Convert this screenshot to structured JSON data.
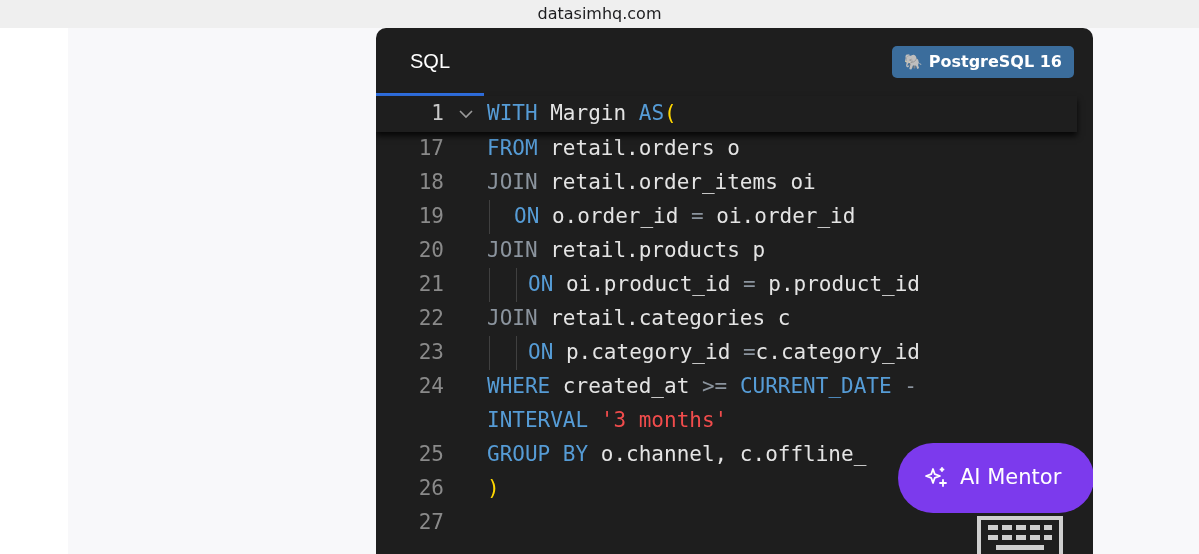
{
  "browser": {
    "url": "datasimhq.com"
  },
  "editor": {
    "tab": {
      "label": "SQL",
      "selected": true
    },
    "engine_badge": {
      "icon": "🐘",
      "label": "PostgreSQL 16"
    },
    "sticky_line": {
      "number": "1",
      "expanded": true,
      "tokens": [
        {
          "kind": "keyword",
          "text": "WITH"
        },
        {
          "kind": "text",
          "text": " Margin "
        },
        {
          "kind": "keyword",
          "text": "AS"
        },
        {
          "kind": "bracket",
          "text": "("
        }
      ]
    },
    "lines": [
      {
        "number": "17",
        "kind": "plain",
        "tokens": [
          {
            "kind": "keyword",
            "text": "FROM"
          },
          {
            "kind": "text",
            "text": " retail.orders o"
          }
        ]
      },
      {
        "number": "18",
        "kind": "plain",
        "tokens": [
          {
            "kind": "keyword_dim",
            "text": "JOIN"
          },
          {
            "kind": "text",
            "text": " retail.order_items oi"
          }
        ]
      },
      {
        "number": "19",
        "kind": "indented",
        "tokens": [
          {
            "kind": "keyword",
            "text": "ON"
          },
          {
            "kind": "text",
            "text": " o.order_id "
          },
          {
            "kind": "operator",
            "text": "="
          },
          {
            "kind": "text",
            "text": " oi.order_id"
          }
        ]
      },
      {
        "number": "20",
        "kind": "plain",
        "tokens": [
          {
            "kind": "keyword_dim",
            "text": "JOIN"
          },
          {
            "kind": "text",
            "text": " retail.products p"
          }
        ]
      },
      {
        "number": "21",
        "kind": "nested",
        "tokens": [
          {
            "kind": "keyword",
            "text": "ON"
          },
          {
            "kind": "text",
            "text": " oi.product_id "
          },
          {
            "kind": "operator",
            "text": "="
          },
          {
            "kind": "text",
            "text": " p.product_id"
          }
        ]
      },
      {
        "number": "22",
        "kind": "plain",
        "tokens": [
          {
            "kind": "keyword_dim",
            "text": "JOIN"
          },
          {
            "kind": "text",
            "text": " retail.categories c"
          }
        ]
      },
      {
        "number": "23",
        "kind": "nested",
        "tokens": [
          {
            "kind": "keyword",
            "text": "ON"
          },
          {
            "kind": "text",
            "text": " p.category_id "
          },
          {
            "kind": "operator",
            "text": "="
          },
          {
            "kind": "text",
            "text": "c.category_id"
          }
        ]
      },
      {
        "number": "24",
        "kind": "plain",
        "tokens": [
          {
            "kind": "keyword",
            "text": "WHERE"
          },
          {
            "kind": "text",
            "text": " created_at "
          },
          {
            "kind": "operator",
            "text": ">="
          },
          {
            "kind": "keyword",
            "text": " CURRENT_DATE"
          },
          {
            "kind": "operator",
            "text": " -"
          }
        ]
      },
      {
        "kind": "plain",
        "tokens": [
          {
            "kind": "keyword",
            "text": "INTERVAL"
          },
          {
            "kind": "string",
            "text": " '3 months'"
          }
        ]
      },
      {
        "number": "25",
        "kind": "plain",
        "tokens": [
          {
            "kind": "keyword",
            "text": "GROUP BY"
          },
          {
            "kind": "text",
            "text": " o.channel, c.offline_"
          }
        ]
      },
      {
        "number": "26",
        "kind": "plain",
        "tokens": [
          {
            "kind": "bracket",
            "text": ")"
          }
        ]
      },
      {
        "number": "27",
        "kind": "plain"
      }
    ]
  },
  "ai_mentor_button": {
    "label": "AI Mentor"
  }
}
